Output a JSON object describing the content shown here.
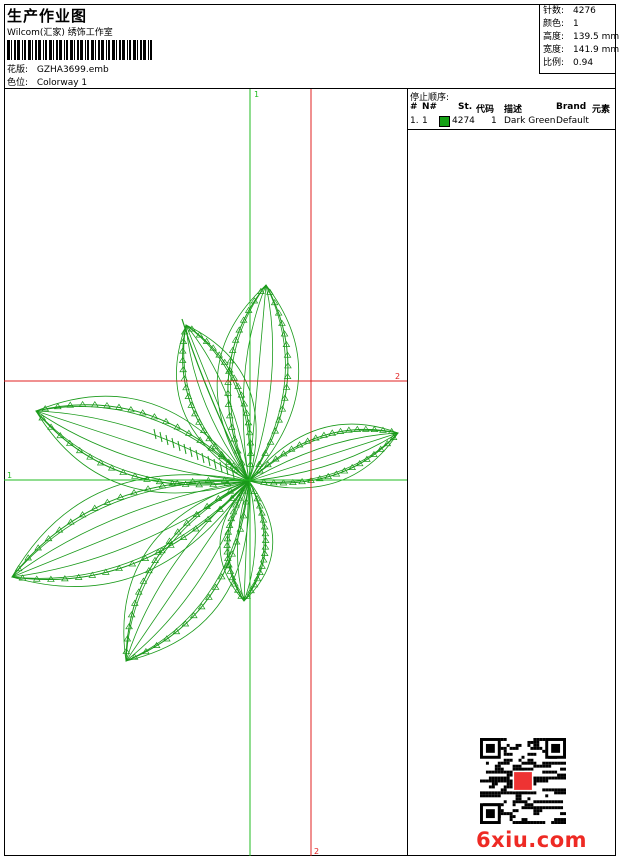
{
  "header": {
    "title": "生产作业图",
    "subtitle": "Wilcom(汇家) 绣饰工作室",
    "design_label": "花版:",
    "design_value": "GZHA3699.emb",
    "colorway_label": "色位:",
    "colorway_value": "Colorway 1"
  },
  "stats": {
    "stitches_label": "针数:",
    "stitches_value": "4276",
    "colors_label": "颜色:",
    "colors_value": "1",
    "height_label": "高度:",
    "height_value": "139.5 mm",
    "width_label": "宽度:",
    "width_value": "141.9 mm",
    "scale_label": "比例:",
    "scale_value": "0.94"
  },
  "axes": {
    "green_top": "1",
    "green_left": "1",
    "red_right": "2",
    "red_bottom": "2",
    "green_color": "#22bb22",
    "red_color": "#e02020"
  },
  "stop_panel": {
    "title": "停止顺序:",
    "columns": [
      "#",
      "N#",
      "St.",
      "代码",
      "描述",
      "Brand",
      "元素"
    ],
    "rows": [
      {
        "idx": "1.",
        "n": "1",
        "color": "#15a015",
        "stitches": "4274",
        "code": "1",
        "desc": "Dark Green",
        "brand": "Default",
        "elem": ""
      }
    ]
  },
  "embroidery": {
    "thread_color": "#1a9a1a"
  },
  "watermark": {
    "text": "6xiu.com",
    "color": "#ee2a24"
  }
}
